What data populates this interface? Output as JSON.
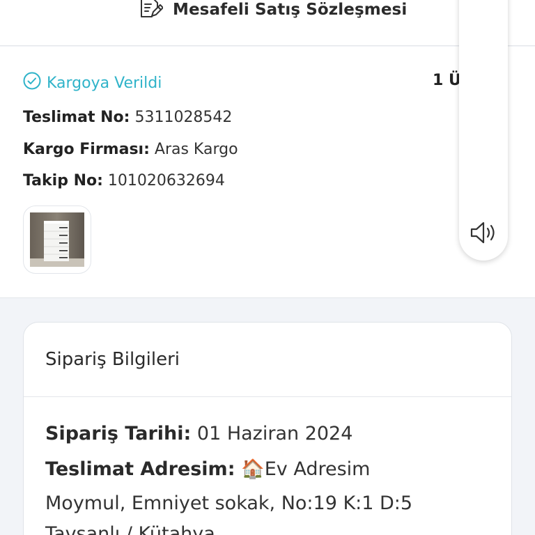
{
  "contract": {
    "label": "Mesafeli Satış Sözleşmesi",
    "icon": "document-edit-icon"
  },
  "shipment": {
    "status": "Kargoya Verildi",
    "status_color": "#2fb3c9",
    "quantity": "1 Ü",
    "delivery_no_label": "Teslimat No:",
    "delivery_no": "5311028542",
    "carrier_label": "Kargo Firması:",
    "carrier": "Aras Kargo",
    "tracking_label": "Takip No:",
    "tracking_no": "101020632694",
    "product_image": "dresser-product-image"
  },
  "accessibility": {
    "icon": "speaker-icon"
  },
  "order_info": {
    "title": "Sipariş Bilgileri",
    "date_label": "Sipariş Tarihi:",
    "date": "01 Haziran 2024",
    "address_label": "Teslimat Adresim:",
    "address_name": "Ev Adresim",
    "address_emoji": "🏠",
    "address_line1": "Moymul, Emniyet sokak, No:19 K:1 D:5",
    "address_line2": "Tavşanlı / Kütahya"
  }
}
